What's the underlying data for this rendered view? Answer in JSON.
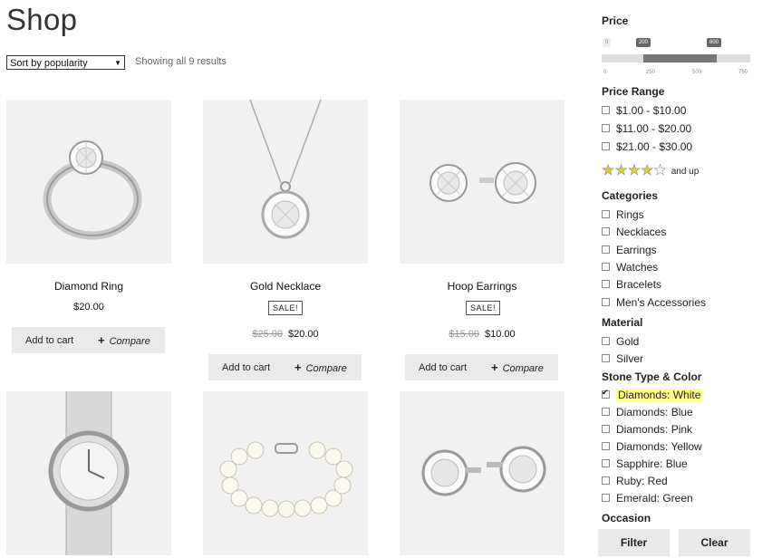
{
  "page": {
    "title": "Shop"
  },
  "toolbar": {
    "sort_value": "Sort by popularity",
    "results_text": "Showing all 9 results"
  },
  "products": [
    {
      "name": "Diamond Ring",
      "price": "$20.00",
      "old_price": "",
      "sale": "",
      "add_to_cart": "Add to cart",
      "compare": "Compare"
    },
    {
      "name": "Gold Necklace",
      "price": "$20.00",
      "old_price": "$25.00",
      "sale": "SALE!",
      "add_to_cart": "Add to cart",
      "compare": "Compare"
    },
    {
      "name": "Hoop Earrings",
      "price": "$10.00",
      "old_price": "$15.00",
      "sale": "SALE!",
      "add_to_cart": "Add to cart",
      "compare": "Compare"
    },
    {
      "name": "",
      "image": "watch"
    },
    {
      "name": "",
      "image": "pearl-bracelet"
    },
    {
      "name": "",
      "image": "cufflinks"
    }
  ],
  "sidebar": {
    "price": {
      "heading": "Price",
      "min_label": "0",
      "low_value": "200",
      "high_value": "600",
      "ticks": [
        "0",
        "250",
        "500",
        "750"
      ],
      "selected_range": [
        200,
        600
      ],
      "scale_max": 750
    },
    "price_range": {
      "heading": "Price Range",
      "items": [
        "$1.00 - $10.00",
        "$11.00 - $20.00",
        "$21.00 - $30.00"
      ]
    },
    "rating": {
      "stars_filled": 4,
      "stars_total": 5,
      "label": "and up"
    },
    "categories": {
      "heading": "Categories",
      "items": [
        "Rings",
        "Necklaces",
        "Earrings",
        "Watches",
        "Bracelets",
        "Men's Accessories"
      ]
    },
    "material": {
      "heading": "Material",
      "items": [
        "Gold",
        "Silver"
      ]
    },
    "stone": {
      "heading": "Stone Type & Color",
      "items": [
        "Diamonds: White",
        "Diamonds: Blue",
        "Diamonds: Pink",
        "Diamonds: Yellow",
        "Sapphire: Blue",
        "Ruby: Red",
        "Emerald: Green"
      ],
      "checked_index": 0
    },
    "occasion": {
      "heading": "Occasion"
    },
    "filter_label": "Filter",
    "clear_label": "Clear"
  },
  "colors": {
    "highlight": "#ffff88",
    "star": "#d4d033"
  }
}
